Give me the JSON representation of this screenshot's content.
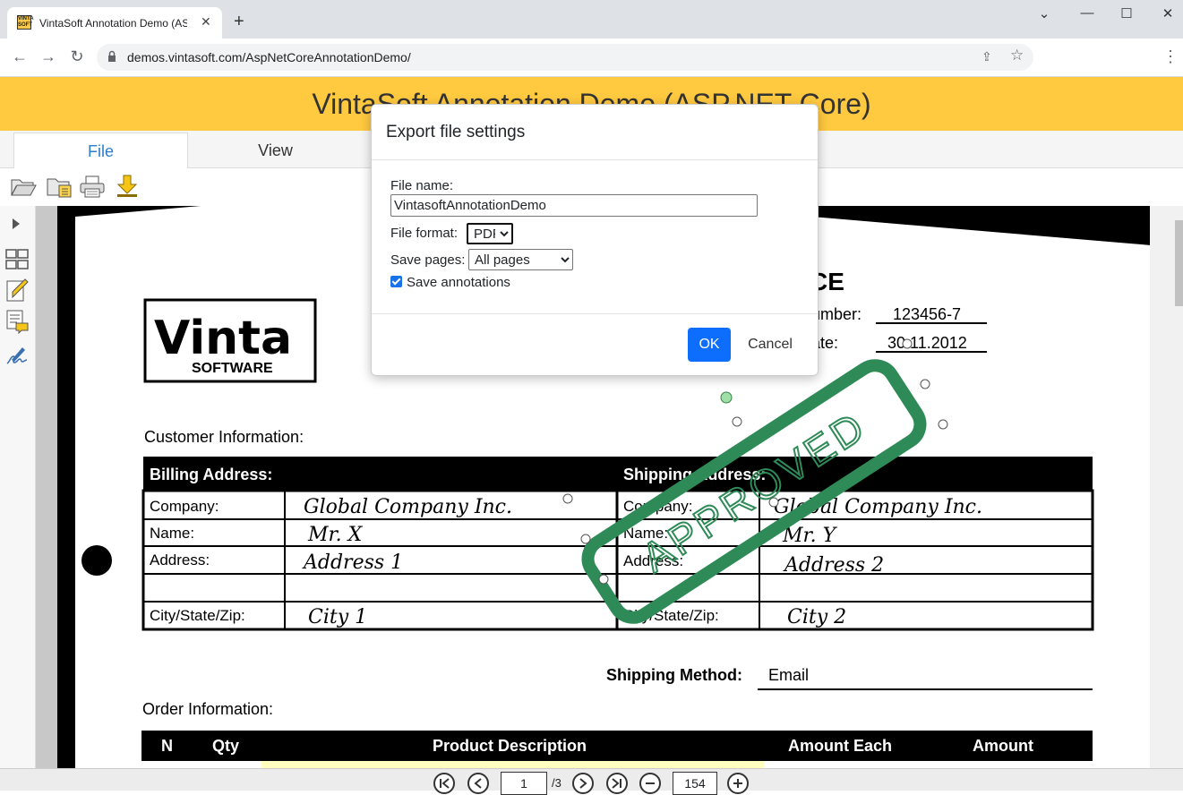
{
  "browser": {
    "tab_title": "VintaSoft Annotation Demo (ASP.NET Core)",
    "favicon_text": "VINTA SOFT",
    "new_tab": "+",
    "url": "demos.vintasoft.com/AspNetCoreAnnotationDemo/"
  },
  "app": {
    "banner_title": "VintaSoft Annotation Demo (ASP.NET Core)",
    "ribbon_tabs": [
      "File",
      "View"
    ],
    "toolbar_icons": [
      "open-file-icon",
      "add-file-icon",
      "print-icon",
      "download-icon"
    ],
    "sidebar_icons": [
      "expand-panel-icon",
      "thumbnails-icon",
      "annotations-icon",
      "comments-icon",
      "signature-icon"
    ]
  },
  "document": {
    "logo_text": "Vinta",
    "logo_sub": "SOFTWARE",
    "heading_fragment": "CE",
    "number_label_fragment": "umber:",
    "number_value": "123456-7",
    "date_label_fragment": "ate:",
    "date_value": "30.11.2012",
    "customer_info": "Customer Information:",
    "billing_header": "Billing Address:",
    "shipping_header": "Shipping Address:",
    "row_labels": [
      "Company:",
      "Name:",
      "Address:",
      "",
      "City/State/Zip:"
    ],
    "billing_values": [
      "Global Company Inc.",
      "Mr. X",
      "Address 1",
      "",
      "City 1"
    ],
    "shipping_values": [
      "Global Company Inc.",
      "Mr. Y",
      "Address 2",
      "",
      "City 2"
    ],
    "shipping_method_label": "Shipping Method:",
    "shipping_method_value": "Email",
    "order_info": "Order Information:",
    "order_columns": [
      "N",
      "Qty",
      "Product Description",
      "Amount Each",
      "Amount"
    ],
    "stamp_text": "APPROVED"
  },
  "pager": {
    "current_page": "1",
    "total_pages": "/3",
    "zoom": "154"
  },
  "dialog": {
    "title": "Export file settings",
    "file_name_label": "File name:",
    "file_name_value": "VintasoftAnnotationDemo",
    "file_format_label": "File format:",
    "file_format_value": "PDF",
    "save_pages_label": "Save pages:",
    "save_pages_value": "All pages",
    "save_annotations_label": "Save annotations",
    "save_annotations_checked": true,
    "ok_label": "OK",
    "cancel_label": "Cancel"
  },
  "colors": {
    "banner": "#ffc940",
    "stamp": "#2e8b57",
    "primary_button": "#0d6efd",
    "active_tab_text": "#2d7ec8"
  }
}
